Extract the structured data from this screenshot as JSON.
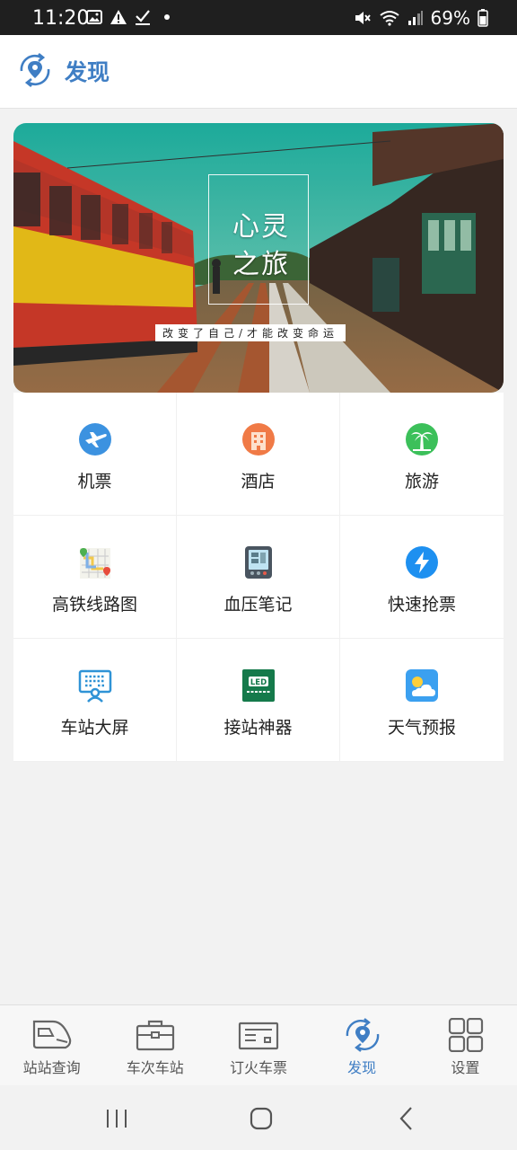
{
  "status_bar": {
    "time": "11:20",
    "battery": "69%",
    "left_icons": [
      "image-icon",
      "warning-icon",
      "check-icon",
      "dot-icon"
    ],
    "right_icons": [
      "mute-icon",
      "wifi-icon",
      "signal-icon",
      "battery-icon"
    ]
  },
  "header": {
    "icon": "discover-location-icon",
    "title": "发现"
  },
  "banner": {
    "line1": "心灵",
    "line2": "之旅",
    "slogan": "改变了自己/才能改变命运"
  },
  "grid": {
    "items": [
      {
        "label": "机票",
        "icon": "airplane-icon"
      },
      {
        "label": "酒店",
        "icon": "hotel-icon"
      },
      {
        "label": "旅游",
        "icon": "palm-tree-icon"
      },
      {
        "label": "高铁线路图",
        "icon": "route-map-icon"
      },
      {
        "label": "血压笔记",
        "icon": "blood-pressure-monitor-icon"
      },
      {
        "label": "快速抢票",
        "icon": "lightning-icon"
      },
      {
        "label": "车站大屏",
        "icon": "station-screen-icon"
      },
      {
        "label": "接站神器",
        "icon": "led-sign-icon"
      },
      {
        "label": "天气预报",
        "icon": "weather-icon"
      }
    ]
  },
  "bottom_nav": {
    "items": [
      {
        "label": "站站查询",
        "icon": "train-icon",
        "active": false
      },
      {
        "label": "车次车站",
        "icon": "briefcase-icon",
        "active": false
      },
      {
        "label": "订火车票",
        "icon": "ticket-icon",
        "active": false
      },
      {
        "label": "发现",
        "icon": "discover-icon",
        "active": true
      },
      {
        "label": "设置",
        "icon": "settings-grid-icon",
        "active": false
      }
    ],
    "active_color": "#3f7ec4"
  },
  "colors": {
    "accent": "#3f7ec4",
    "status_bar_bg": "#1f1f1f"
  }
}
